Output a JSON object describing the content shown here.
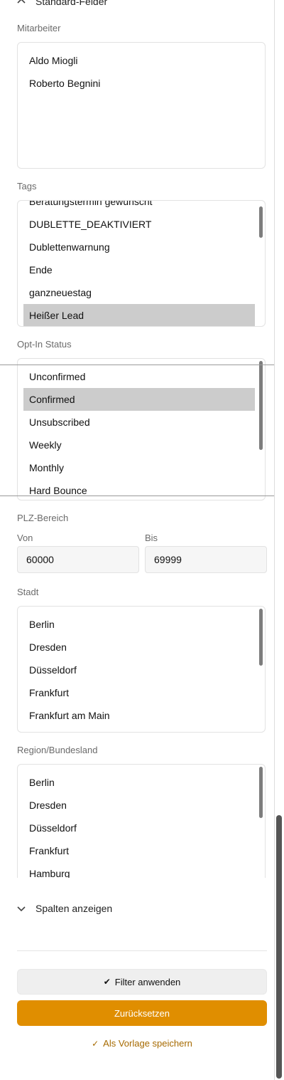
{
  "standard_section": {
    "title": "Standard-Felder"
  },
  "mitarbeiter": {
    "label": "Mitarbeiter",
    "items": [
      "Aldo Miogli",
      "Roberto Begnini"
    ]
  },
  "tags": {
    "label": "Tags",
    "items": [
      "Beratungstermin gewünscht",
      "DUBLETTE_DEAKTIVIERT",
      "Dublettenwarnung",
      "Ende",
      "ganzneuestag",
      "Heißer Lead"
    ],
    "selected": "Heißer Lead"
  },
  "optin": {
    "label": "Opt-In Status",
    "items": [
      "Unconfirmed",
      "Confirmed",
      "Unsubscribed",
      "Weekly",
      "Monthly",
      "Hard Bounce"
    ],
    "selected": "Confirmed"
  },
  "plz": {
    "label": "PLZ-Bereich",
    "from_label": "Von",
    "from_value": "60000",
    "to_label": "Bis",
    "to_value": "69999"
  },
  "stadt": {
    "label": "Stadt",
    "items": [
      "Berlin",
      "Dresden",
      "Düsseldorf",
      "Frankfurt",
      "Frankfurt am Main"
    ]
  },
  "region": {
    "label": "Region/Bundesland",
    "items": [
      "Berlin",
      "Dresden",
      "Düsseldorf",
      "Frankfurt",
      "Hamburg"
    ]
  },
  "columns_section": {
    "title": "Spalten anzeigen"
  },
  "actions": {
    "apply_label": "Filter anwenden",
    "reset_label": "Zurücksetzen",
    "save_template_label": "Als Vorlage speichern"
  },
  "colors": {
    "accent": "#e08e00",
    "selected_row": "#cccccc",
    "link": "#a66a00"
  }
}
